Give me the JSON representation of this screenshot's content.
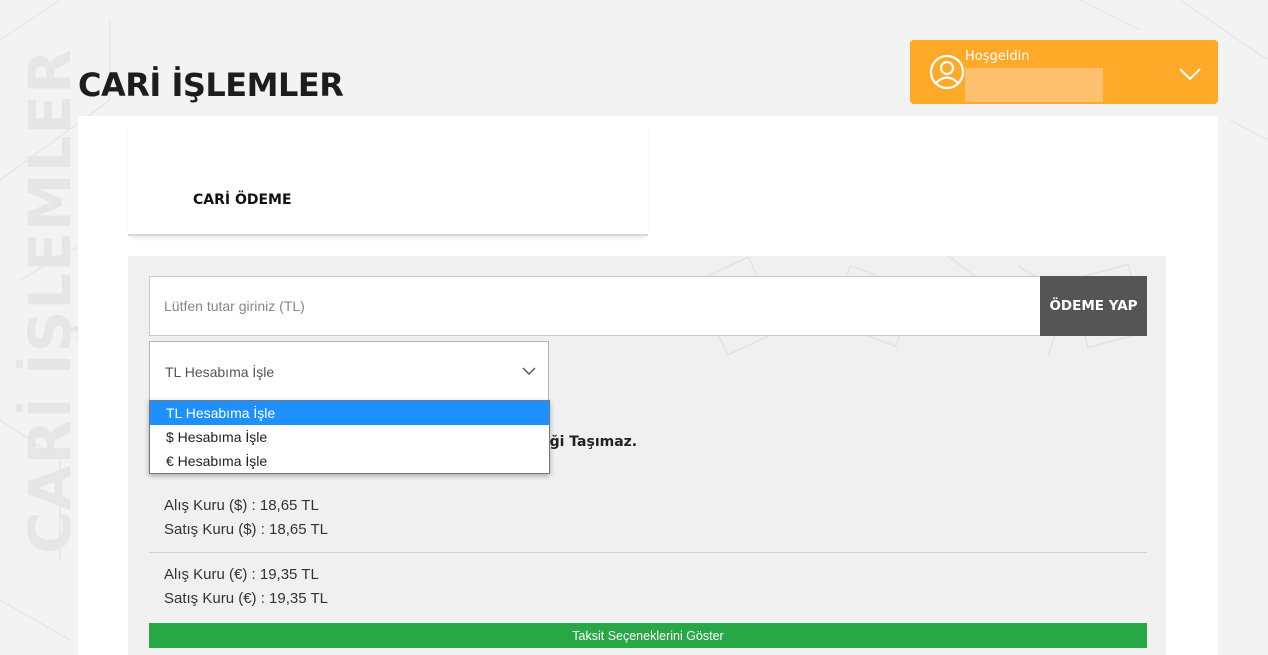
{
  "page": {
    "watermark": "CARİ İŞLEMLER",
    "title": "CARİ İŞLEMLER"
  },
  "user": {
    "welcome": "Hoşgeldin",
    "icon": "user-circle-icon",
    "menu_icon": "chevron-down-icon"
  },
  "tabs": [
    {
      "label": "CARİ ÖDEME",
      "active": true
    }
  ],
  "payment": {
    "amount_placeholder": "Lütfen tutar giriniz (TL)",
    "amount_value": "",
    "pay_label": "ÖDEME YAP",
    "account_selected": "TL Hesabıma İşle",
    "account_options": [
      "TL Hesabıma İşle",
      "$ Hesabıma İşle",
      "€ Hesabıma İşle"
    ],
    "notice_visible": "liği Taşımaz."
  },
  "rates": {
    "usd_buy": "Alış Kuru ($) : 18,65 TL",
    "usd_sell": "Satış Kuru ($) : 18,65 TL",
    "eur_buy": "Alış Kuru (€) : 19,35 TL",
    "eur_sell": "Satış Kuru (€) : 19,35 TL"
  },
  "installment_label": "Taksit Seçeneklerini Göster",
  "colors": {
    "accent_orange": "#fea928",
    "pay_button": "#555555",
    "installment_green": "#28a745",
    "selected_option": "#1e90ff"
  }
}
